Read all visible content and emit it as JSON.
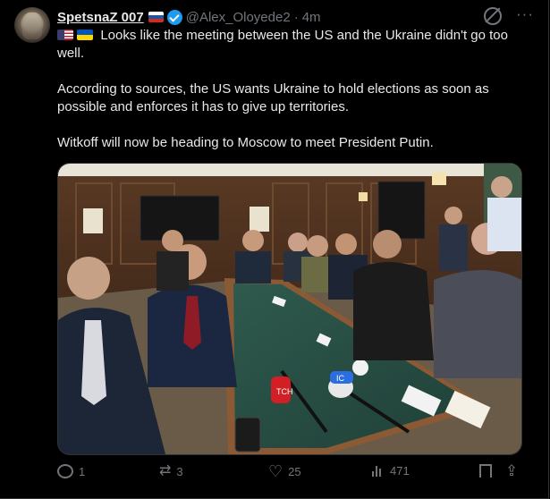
{
  "tweet": {
    "display_name": "SpetsnaZ 007",
    "handle": "@Alex_Oloyede2",
    "separator": "·",
    "time": "4m",
    "paragraph_1": " Looks like the meeting between the US and the Ukraine didn't go too well.",
    "paragraph_2": "According to sources, the US wants Ukraine to hold elections as soon as possible and enforces it has to give up territories.",
    "paragraph_3": "Witkoff will now be heading to Moscow to meet President Putin.",
    "flags": [
      "flag-us-icon",
      "flag-ua-icon",
      "flag-ru-icon"
    ]
  },
  "media": {
    "microphone_labels": [
      "ТСН",
      "IC"
    ]
  },
  "actions": {
    "replies": "1",
    "reposts": "3",
    "likes": "25",
    "views": "471"
  },
  "colors": {
    "background": "#000000",
    "text": "#e7e9ea",
    "muted": "#71767b",
    "verified": "#1d9bf0",
    "divider": "#2f3336"
  }
}
